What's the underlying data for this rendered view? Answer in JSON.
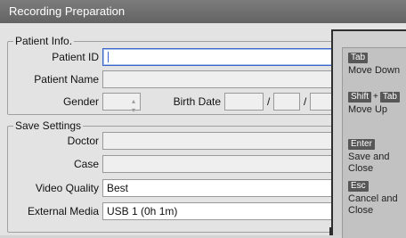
{
  "window": {
    "title": "Recording Preparation"
  },
  "patient": {
    "legend": "Patient Info.",
    "id_label": "Patient ID",
    "id_value": "",
    "name_label": "Patient Name",
    "name_value": "",
    "gender_label": "Gender",
    "gender_value": "",
    "birth_label": "Birth Date",
    "date_sep1": "/",
    "date_sep2": "/"
  },
  "save": {
    "legend": "Save Settings",
    "doctor_label": "Doctor",
    "doctor_value": "",
    "case_label": "Case",
    "case_value": "",
    "quality_label": "Video Quality",
    "quality_value": "Best",
    "media_label": "External Media",
    "media_value": "USB 1 (0h 1m)"
  },
  "help": {
    "tab_key": "Tab",
    "tab_desc": "Move Down",
    "shift_key": "Shift",
    "plus": "+",
    "shift_tab_key": "Tab",
    "shift_tab_desc": "Move Up",
    "enter_key": "Enter",
    "enter_desc": "Save and Close",
    "esc_key": "Esc",
    "esc_desc": "Cancel and Close"
  }
}
